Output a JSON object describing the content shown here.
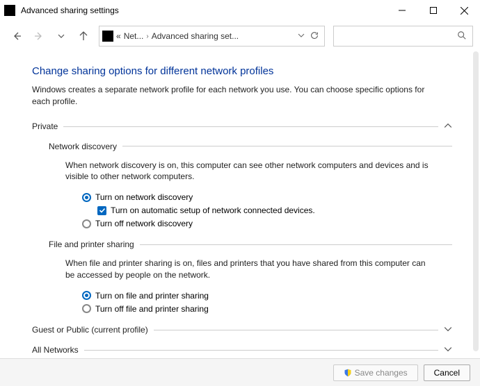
{
  "window": {
    "title": "Advanced sharing settings"
  },
  "breadcrumb": {
    "prev_symbol": "«",
    "item1": "Net...",
    "item2": "Advanced sharing set..."
  },
  "heading": "Change sharing options for different network profiles",
  "intro": "Windows creates a separate network profile for each network you use. You can choose specific options for each profile.",
  "sections": {
    "private": {
      "label": "Private",
      "network_discovery": {
        "title": "Network discovery",
        "desc": "When network discovery is on, this computer can see other network computers and devices and is visible to other network computers.",
        "opt_on": "Turn on network discovery",
        "opt_auto": "Turn on automatic setup of network connected devices.",
        "opt_off": "Turn off network discovery"
      },
      "file_printer": {
        "title": "File and printer sharing",
        "desc": "When file and printer sharing is on, files and printers that you have shared from this computer can be accessed by people on the network.",
        "opt_on": "Turn on file and printer sharing",
        "opt_off": "Turn off file and printer sharing"
      }
    },
    "guest": {
      "label": "Guest or Public (current profile)"
    },
    "all": {
      "label": "All Networks"
    }
  },
  "footer": {
    "save": "Save changes",
    "cancel": "Cancel"
  }
}
